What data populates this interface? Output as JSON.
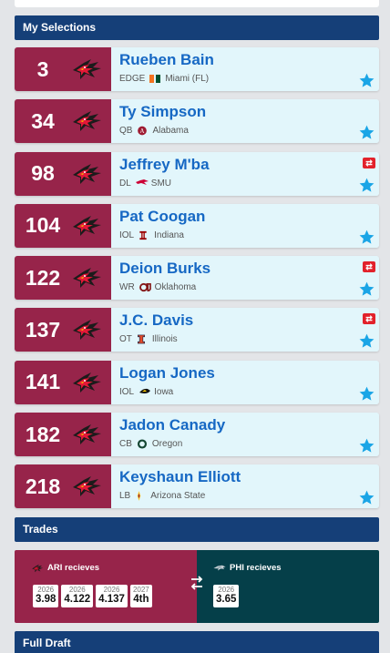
{
  "sections": {
    "my_selections": "My Selections",
    "trades": "Trades",
    "full_draft": "Full Draft"
  },
  "picks": [
    {
      "num": "3",
      "name": "Rueben Bain",
      "pos": "EDGE",
      "school": "Miami (FL)",
      "school_icon": "miami-logo",
      "traded": false
    },
    {
      "num": "34",
      "name": "Ty Simpson",
      "pos": "QB",
      "school": "Alabama",
      "school_icon": "alabama-logo",
      "traded": false
    },
    {
      "num": "98",
      "name": "Jeffrey M'ba",
      "pos": "DL",
      "school": "SMU",
      "school_icon": "smu-logo",
      "traded": true
    },
    {
      "num": "104",
      "name": "Pat Coogan",
      "pos": "IOL",
      "school": "Indiana",
      "school_icon": "indiana-logo",
      "traded": false
    },
    {
      "num": "122",
      "name": "Deion Burks",
      "pos": "WR",
      "school": "Oklahoma",
      "school_icon": "oklahoma-logo",
      "traded": true
    },
    {
      "num": "137",
      "name": "J.C. Davis",
      "pos": "OT",
      "school": "Illinois",
      "school_icon": "illinois-logo",
      "traded": true
    },
    {
      "num": "141",
      "name": "Logan Jones",
      "pos": "IOL",
      "school": "Iowa",
      "school_icon": "iowa-logo",
      "traded": false
    },
    {
      "num": "182",
      "name": "Jadon Canady",
      "pos": "CB",
      "school": "Oregon",
      "school_icon": "oregon-logo",
      "traded": false
    },
    {
      "num": "218",
      "name": "Keyshaun Elliott",
      "pos": "LB",
      "school": "Arizona State",
      "school_icon": "arizona-state-logo",
      "traded": false
    }
  ],
  "trade": {
    "ari_label": "ARI recieves",
    "phi_label": "PHI recieves",
    "ari_assets": [
      {
        "year": "2026",
        "value": "3.98"
      },
      {
        "year": "2026",
        "value": "4.122"
      },
      {
        "year": "2026",
        "value": "4.137"
      },
      {
        "year": "2027",
        "value": "4th"
      }
    ],
    "phi_assets": [
      {
        "year": "2026",
        "value": "3.65"
      }
    ]
  },
  "colors": {
    "cardinals_red": "#97244a",
    "header_blue": "#153f78",
    "name_blue": "#1668c4",
    "row_bg": "#e2f6fb",
    "star_blue": "#1aa5e6",
    "trade_red": "#e2222b",
    "eagles_teal": "#053f49"
  },
  "icons": {
    "team": "cardinal-head-icon",
    "star": "star-icon",
    "traded": "trade-swap-icon",
    "swap": "swap-arrows-icon"
  }
}
